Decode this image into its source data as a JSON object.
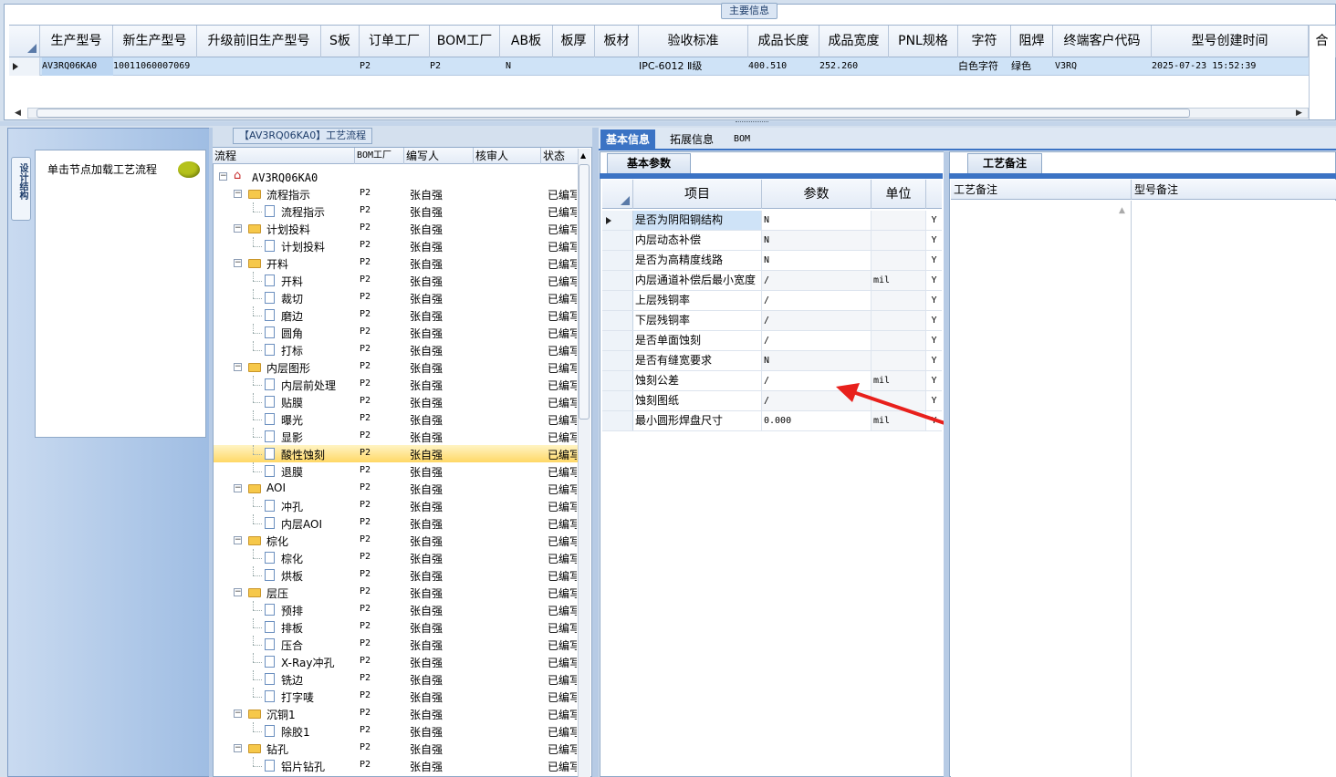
{
  "main_info": {
    "legend": "主要信息",
    "columns": [
      "生产型号",
      "新生产型号",
      "升级前旧生产型号",
      "S板",
      "订单工厂",
      "BOM工厂",
      "AB板",
      "板厚",
      "板材",
      "验收标准",
      "成品长度",
      "成品宽度",
      "PNL规格",
      "字符",
      "阻焊",
      "终端客户代码",
      "型号创建时间",
      "合"
    ],
    "row": {
      "生产型号": "AV3RQ06KA0",
      "新生产型号": "10011060007069",
      "订单工厂": "P2",
      "BOM工厂": "P2",
      "AB板": "N",
      "验收标准": "IPC-6012 Ⅱ级",
      "成品长度": "400.510",
      "成品宽度": "252.260",
      "字符": "白色字符",
      "阻焊": "绿色",
      "终端客户代码": "V3RQ",
      "型号创建时间": "2025-07-23 15:52:39"
    }
  },
  "left_panel": {
    "side_tab": "设计结构",
    "node_hint": "单击节点加载工艺流程"
  },
  "tree": {
    "legend": "【AV3RQ06KA0】工艺流程",
    "columns": [
      "流程",
      "BOM工厂",
      "编写人",
      "核审人",
      "状态"
    ],
    "root": "AV3RQ06KA0",
    "rows": [
      {
        "label": "流程指示",
        "type": "folder",
        "factory": "P2",
        "writer": "张自强",
        "status": "已编写"
      },
      {
        "label": "流程指示",
        "type": "file",
        "factory": "P2",
        "writer": "张自强",
        "status": "已编写"
      },
      {
        "label": "计划投料",
        "type": "folder",
        "factory": "P2",
        "writer": "张自强",
        "status": "已编写"
      },
      {
        "label": "计划投料",
        "type": "file",
        "factory": "P2",
        "writer": "张自强",
        "status": "已编写"
      },
      {
        "label": "开料",
        "type": "folder",
        "factory": "P2",
        "writer": "张自强",
        "status": "已编写"
      },
      {
        "label": "开料",
        "type": "file",
        "factory": "P2",
        "writer": "张自强",
        "status": "已编写"
      },
      {
        "label": "裁切",
        "type": "file",
        "factory": "P2",
        "writer": "张自强",
        "status": "已编写"
      },
      {
        "label": "磨边",
        "type": "file",
        "factory": "P2",
        "writer": "张自强",
        "status": "已编写"
      },
      {
        "label": "圆角",
        "type": "file",
        "factory": "P2",
        "writer": "张自强",
        "status": "已编写"
      },
      {
        "label": "打标",
        "type": "file",
        "factory": "P2",
        "writer": "张自强",
        "status": "已编写"
      },
      {
        "label": "内层图形",
        "type": "folder",
        "factory": "P2",
        "writer": "张自强",
        "status": "已编写"
      },
      {
        "label": "内层前处理",
        "type": "file",
        "factory": "P2",
        "writer": "张自强",
        "status": "已编写"
      },
      {
        "label": "贴膜",
        "type": "file",
        "factory": "P2",
        "writer": "张自强",
        "status": "已编写"
      },
      {
        "label": "曝光",
        "type": "file",
        "factory": "P2",
        "writer": "张自强",
        "status": "已编写"
      },
      {
        "label": "显影",
        "type": "file",
        "factory": "P2",
        "writer": "张自强",
        "status": "已编写"
      },
      {
        "label": "酸性蚀刻",
        "type": "file",
        "factory": "P2",
        "writer": "张自强",
        "status": "已编写",
        "selected": true
      },
      {
        "label": "退膜",
        "type": "file",
        "factory": "P2",
        "writer": "张自强",
        "status": "已编写"
      },
      {
        "label": "AOI",
        "type": "folder",
        "factory": "P2",
        "writer": "张自强",
        "status": "已编写"
      },
      {
        "label": "冲孔",
        "type": "file",
        "factory": "P2",
        "writer": "张自强",
        "status": "已编写"
      },
      {
        "label": "内层AOI",
        "type": "file",
        "factory": "P2",
        "writer": "张自强",
        "status": "已编写"
      },
      {
        "label": "棕化",
        "type": "folder",
        "factory": "P2",
        "writer": "张自强",
        "status": "已编写"
      },
      {
        "label": "棕化",
        "type": "file",
        "factory": "P2",
        "writer": "张自强",
        "status": "已编写"
      },
      {
        "label": "烘板",
        "type": "file",
        "factory": "P2",
        "writer": "张自强",
        "status": "已编写"
      },
      {
        "label": "层压",
        "type": "folder",
        "factory": "P2",
        "writer": "张自强",
        "status": "已编写"
      },
      {
        "label": "预排",
        "type": "file",
        "factory": "P2",
        "writer": "张自强",
        "status": "已编写"
      },
      {
        "label": "排板",
        "type": "file",
        "factory": "P2",
        "writer": "张自强",
        "status": "已编写"
      },
      {
        "label": "压合",
        "type": "file",
        "factory": "P2",
        "writer": "张自强",
        "status": "已编写"
      },
      {
        "label": "X-Ray冲孔",
        "type": "file",
        "factory": "P2",
        "writer": "张自强",
        "status": "已编写"
      },
      {
        "label": "铣边",
        "type": "file",
        "factory": "P2",
        "writer": "张自强",
        "status": "已编写"
      },
      {
        "label": "打字唛",
        "type": "file",
        "factory": "P2",
        "writer": "张自强",
        "status": "已编写"
      },
      {
        "label": "沉铜1",
        "type": "folder",
        "factory": "P2",
        "writer": "张自强",
        "status": "已编写"
      },
      {
        "label": "除胶1",
        "type": "file",
        "factory": "P2",
        "writer": "张自强",
        "status": "已编写"
      },
      {
        "label": "钻孔",
        "type": "folder",
        "factory": "P2",
        "writer": "张自强",
        "status": "已编写"
      },
      {
        "label": "铝片钻孔",
        "type": "file",
        "factory": "P2",
        "writer": "张自强",
        "status": "已编写"
      }
    ]
  },
  "right_tabs": [
    "基本信息",
    "拓展信息",
    "BOM"
  ],
  "params": {
    "tab": "基本参数",
    "columns": [
      "项目",
      "参数",
      "单位"
    ],
    "rows": [
      {
        "item": "是否为阴阳铜结构",
        "value": "N",
        "unit": "",
        "flag": "Y"
      },
      {
        "item": "内层动态补偿",
        "value": "N",
        "unit": "",
        "flag": "Y"
      },
      {
        "item": "是否为高精度线路",
        "value": "N",
        "unit": "",
        "flag": "Y"
      },
      {
        "item": "内层通道补偿后最小宽度",
        "value": "/",
        "unit": "mil",
        "flag": "Y"
      },
      {
        "item": "上层残铜率",
        "value": "/",
        "unit": "",
        "flag": "Y"
      },
      {
        "item": "下层残铜率",
        "value": "/",
        "unit": "",
        "flag": "Y"
      },
      {
        "item": "是否单面蚀刻",
        "value": "/",
        "unit": "",
        "flag": "Y"
      },
      {
        "item": "是否有缝宽要求",
        "value": "N",
        "unit": "",
        "flag": "Y"
      },
      {
        "item": "蚀刻公差",
        "value": "/",
        "unit": "mil",
        "flag": "Y"
      },
      {
        "item": "蚀刻图纸",
        "value": "/",
        "unit": "",
        "flag": "Y"
      },
      {
        "item": "最小圆形焊盘尺寸",
        "value": "0.000",
        "unit": "mil",
        "flag": "Y"
      }
    ]
  },
  "remarks": {
    "tab": "工艺备注",
    "columns": [
      "工艺备注",
      "型号备注"
    ]
  },
  "colors": {
    "accent": "#3b73c4",
    "selected_row": "#cfe3f7",
    "annotation_arrow": "#e8201c"
  }
}
